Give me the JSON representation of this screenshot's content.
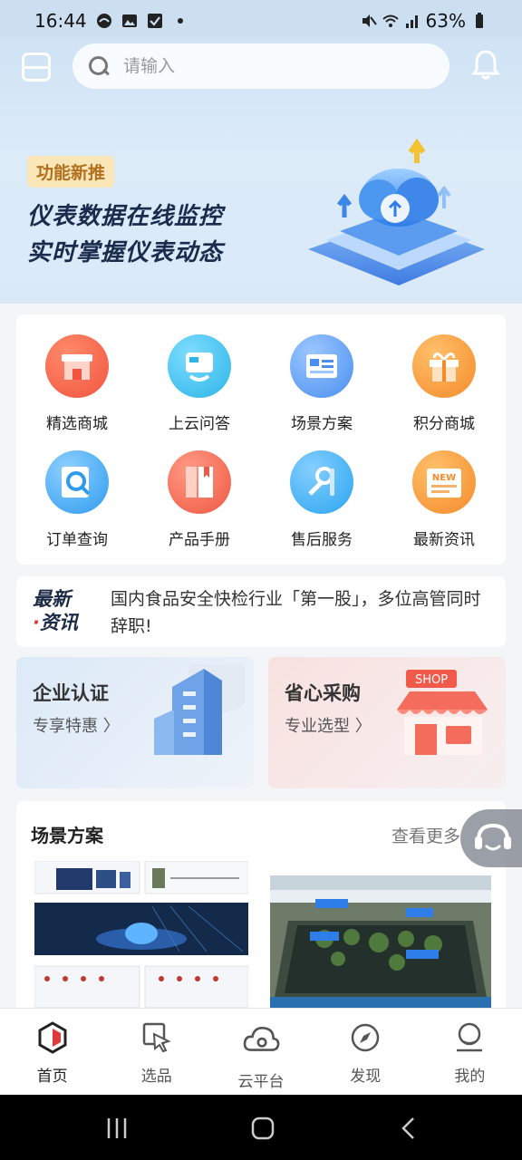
{
  "status_bar": {
    "time": "16:44",
    "battery": "63%"
  },
  "header": {
    "search_placeholder": "请输入"
  },
  "hero": {
    "tag": "功能新推",
    "line1": "仪表数据在线监控",
    "line2": "实时掌握仪表动态"
  },
  "grid": [
    {
      "label": "精选商城",
      "icon": "shop-icon",
      "color": "#f1553f"
    },
    {
      "label": "上云问答",
      "icon": "qa-icon",
      "color": "#2bb5e8"
    },
    {
      "label": "场景方案",
      "icon": "scene-icon",
      "color": "#4a8ff0"
    },
    {
      "label": "积分商城",
      "icon": "gift-icon",
      "color": "#f58a2a"
    },
    {
      "label": "订单查询",
      "icon": "order-search-icon",
      "color": "#2e9bef"
    },
    {
      "label": "产品手册",
      "icon": "manual-icon",
      "color": "#ef5843"
    },
    {
      "label": "售后服务",
      "icon": "service-icon",
      "color": "#2aa4ef"
    },
    {
      "label": "最新资讯",
      "icon": "news-icon",
      "color": "#f58a2a"
    }
  ],
  "news": {
    "logo_line1": "最新",
    "logo_line2": "资讯",
    "text": "国内食品安全快检行业「第一股」，多位高管同时辞职!"
  },
  "promos": {
    "left": {
      "title": "企业认证",
      "subtitle": "专享特惠 〉"
    },
    "right": {
      "title": "省心采购",
      "subtitle": "专业选型 〉",
      "sign": "SHOP"
    }
  },
  "scene": {
    "title": "场景方案",
    "more": "查看更多"
  },
  "bottom_nav": [
    {
      "label": "首页",
      "icon": "home-icon"
    },
    {
      "label": "选品",
      "icon": "select-icon"
    },
    {
      "label": "云平台",
      "icon": "cloud-icon"
    },
    {
      "label": "发现",
      "icon": "compass-icon"
    },
    {
      "label": "我的",
      "icon": "profile-icon"
    }
  ],
  "colors": {
    "accent_red": "#e0393a",
    "hero_text": "#1b2b4d",
    "tag_bg": "#fbe6b8"
  }
}
